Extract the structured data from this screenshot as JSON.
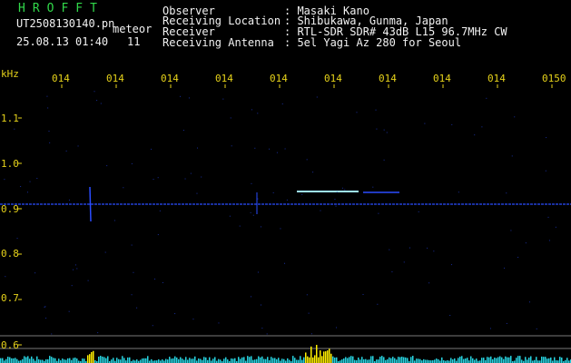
{
  "header": {
    "brand": "HROFFT",
    "filename": "UT2508130140.pn",
    "type_label": "meteor",
    "datetime": "25.08.13 01:40",
    "count": "11",
    "info": [
      {
        "key": "Observer",
        "value": ": Masaki Kano"
      },
      {
        "key": "Receiving Location",
        "value": ": Shibukawa, Gunma, Japan"
      },
      {
        "key": "Receiver",
        "value": ": RTL-SDR SDR# 43dB L15 96.7MHz CW"
      },
      {
        "key": "Receiving Antenna",
        "value": ": 5el Yagi Az 280 for Seoul"
      }
    ]
  },
  "time_axis": {
    "labels": [
      "014",
      "014",
      "014",
      "014",
      "014",
      "014",
      "014",
      "014",
      "014",
      "0150"
    ]
  },
  "freq_axis": {
    "unit": "kHz",
    "labels": [
      "1.1",
      "1.0",
      "0.9",
      "0.8",
      "0.7",
      "0.6"
    ]
  },
  "colors": {
    "background": "#000000",
    "header_text": "#f2f2f2",
    "brand": "#31d84a",
    "tick_text": "#e6d21a",
    "signal": "#2a4cff",
    "meteor_echo": "#9fe8ff",
    "level_bars": "#27d3e0",
    "level_peak": "#ffef00"
  }
}
